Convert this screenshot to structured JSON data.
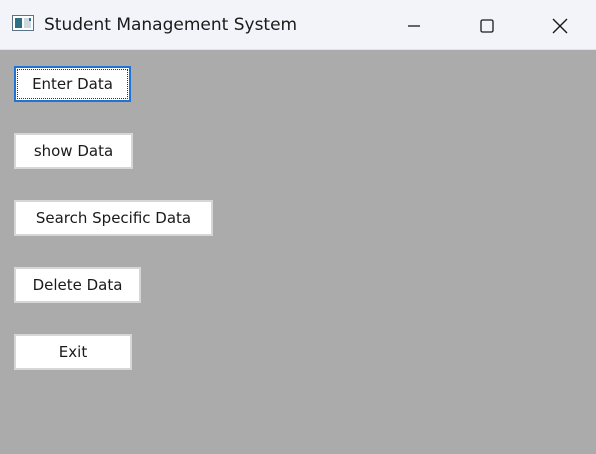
{
  "window": {
    "title": "Student Management System",
    "icon": "app-window-icon",
    "background": "#ababab"
  },
  "controls": {
    "minimize_icon": "minimize-icon",
    "maximize_icon": "maximize-icon",
    "close_icon": "close-icon"
  },
  "buttons": [
    {
      "label": "Enter Data",
      "focused": true
    },
    {
      "label": "show Data",
      "focused": false
    },
    {
      "label": "Search Specific Data",
      "focused": false
    },
    {
      "label": "Delete Data",
      "focused": false
    },
    {
      "label": "Exit",
      "focused": false
    }
  ],
  "colors": {
    "focus_border": "#1e73d3",
    "button_border": "#d6d6d6"
  }
}
